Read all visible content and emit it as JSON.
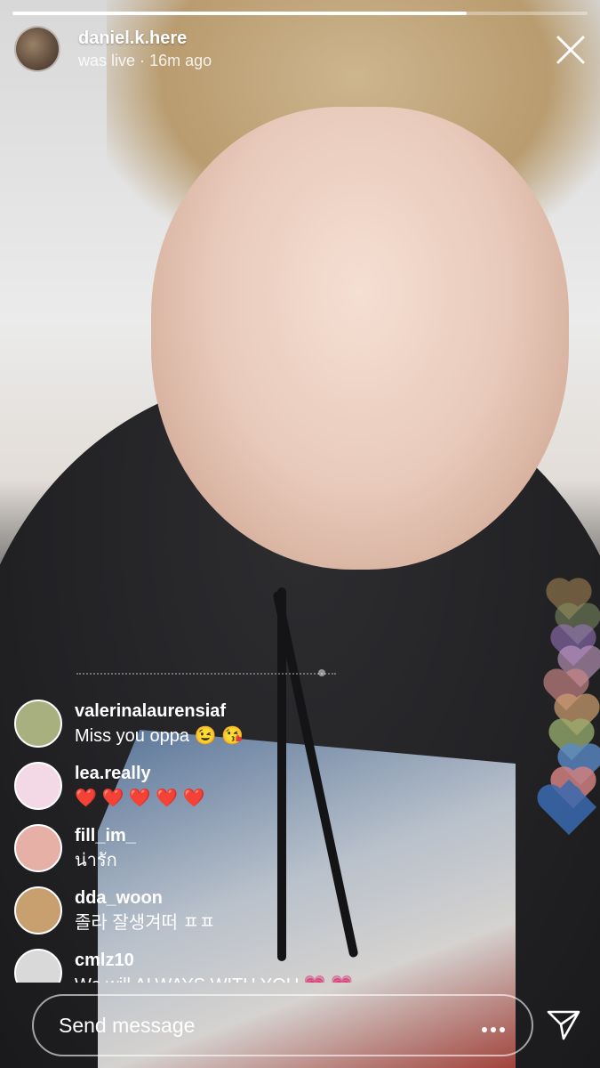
{
  "story": {
    "progress": 0.79
  },
  "header": {
    "username": "daniel.k.here",
    "status": "was live",
    "separator": "·",
    "time_ago": "16m ago",
    "avatar_icon": "cat-avatar"
  },
  "comments": [
    {
      "username": "valerinalaurensiaf",
      "text": "Miss you oppa 😉 😘",
      "avatar_color": "#a7b07e"
    },
    {
      "username": "lea.really",
      "text": "❤️ ❤️ ❤️ ❤️ ❤️",
      "avatar_color": "#f3d9e6"
    },
    {
      "username": "fill_im_",
      "text": "น่ารัก",
      "avatar_color": "#e6b0a6"
    },
    {
      "username": "dda_woon",
      "text": "졸라 잘생겨떠 ㅍㅍ",
      "avatar_color": "#c8a070"
    },
    {
      "username": "cmlz10",
      "text": "We will ALWAYS WITH YOU 💗 💗",
      "avatar_color": "#d9d9d9"
    }
  ],
  "floating_hearts": [
    {
      "color": "#c9a060"
    },
    {
      "color": "#8a9a6a"
    },
    {
      "color": "#a07ac8"
    },
    {
      "color": "#c8a0c8"
    },
    {
      "color": "#d08a8a"
    },
    {
      "color": "#d0a070"
    },
    {
      "color": "#9ab070"
    },
    {
      "color": "#5a8ac8"
    },
    {
      "color": "#d08080"
    },
    {
      "color": "#3a6ab0"
    }
  ],
  "composer": {
    "placeholder": "Send message"
  },
  "icons": {
    "close": "close-icon",
    "more": "more-icon",
    "send": "send-icon"
  }
}
